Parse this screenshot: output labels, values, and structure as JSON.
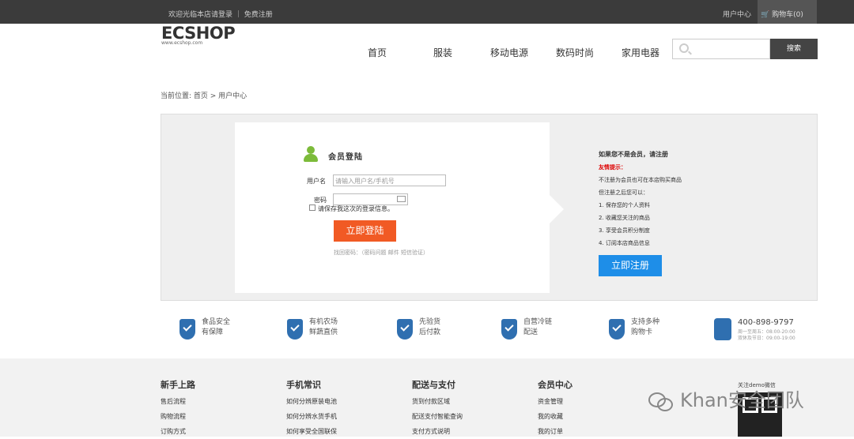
{
  "topbar": {
    "welcome": "欢迎光临本店请登录 ｜ 免费注册",
    "user_center": "用户中心",
    "cart": "购物车(0)"
  },
  "logo": {
    "text": "ECSHOP",
    "sub": "www.ecshop.com"
  },
  "nav": [
    "首页",
    "服装",
    "移动电源",
    "数码时尚",
    "家用电器"
  ],
  "search": {
    "placeholder": "",
    "button": "搜索"
  },
  "breadcrumb": "当前位置: 首页 > 用户中心",
  "login": {
    "title": "会员登陆",
    "username_label": "用户名",
    "username_placeholder": "请输入用户名/手机号",
    "password_label": "密码",
    "remember": "请保存我这次的登录信息。",
    "submit": "立即登陆",
    "forgot": "找回密码：（密码问题 邮件 短信验证）"
  },
  "register": {
    "heading": "如果您不是会员，请注册",
    "hint_title": "友情提示：",
    "line1": "不注册为会员也可在本店购买商品",
    "line2": "但注册之后您可以：",
    "benefits": [
      "1. 保存您的个人资料",
      "2. 收藏您关注的商品",
      "3. 享受会员积分制度",
      "4. 订阅本店商品信息"
    ],
    "button": "立即注册"
  },
  "features": [
    {
      "l1": "食品安全",
      "l2": "有保障",
      "icon": "shield-check-icon"
    },
    {
      "l1": "有机农场",
      "l2": "鲜蔬直供",
      "icon": "farm-icon"
    },
    {
      "l1": "先验货",
      "l2": "后付款",
      "icon": "inspect-icon"
    },
    {
      "l1": "自营冷链",
      "l2": "配送",
      "icon": "truck-icon"
    },
    {
      "l1": "支持多种",
      "l2": "购物卡",
      "icon": "card-icon"
    }
  ],
  "contact": {
    "phone": "400-898-9797",
    "hours1": "周一至周五：08:00-20:00",
    "hours2": "双休及节日：09:00-19:00"
  },
  "footer": {
    "cols": [
      {
        "title": "新手上路",
        "items": [
          "售后流程",
          "购物流程",
          "订购方式"
        ]
      },
      {
        "title": "手机常识",
        "items": [
          "如何分辨原装电池",
          "如何分辨水货手机",
          "如何享受全国联保"
        ]
      },
      {
        "title": "配送与支付",
        "items": [
          "货到付款区域",
          "配送支付智能查询",
          "支付方式说明"
        ]
      },
      {
        "title": "会员中心",
        "items": [
          "资金管理",
          "我的收藏",
          "我的订单"
        ]
      }
    ],
    "wechat": "关注demo微信",
    "watermark": "Khan安全团队"
  }
}
